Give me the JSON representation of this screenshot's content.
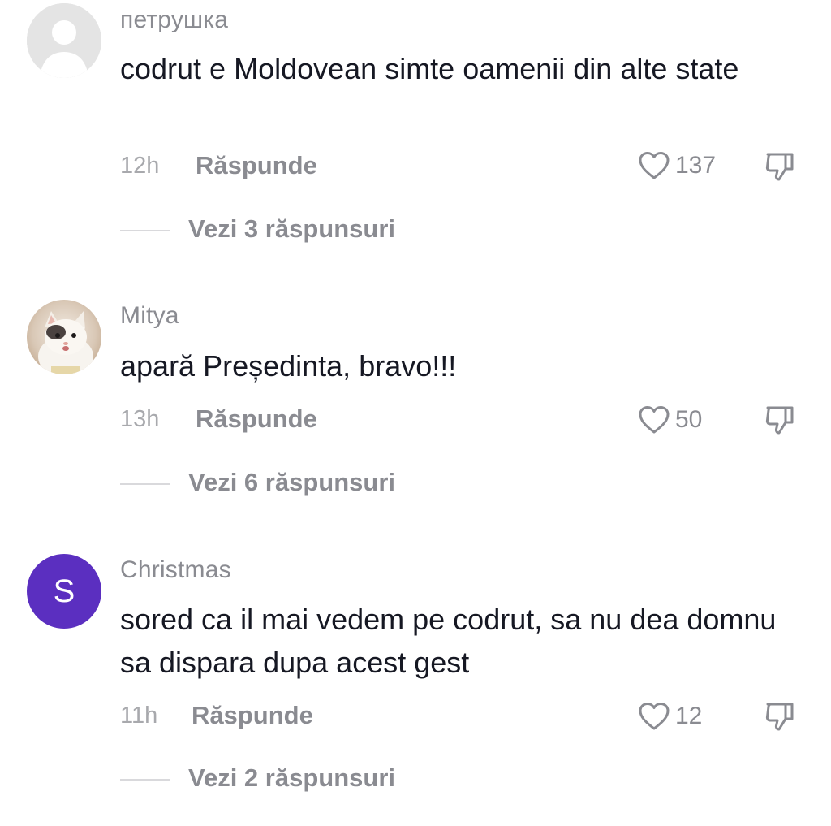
{
  "comments": [
    {
      "avatar": "default-person-avatar",
      "username": "петрушка",
      "text": "codrut e Moldovean simte oamenii din alte state",
      "time": "12h",
      "reply_label": "Răspunde",
      "likes": "137",
      "view_replies": "Vezi 3 răspunsuri"
    },
    {
      "avatar": "cat-photo-avatar",
      "username": "Mitya",
      "text": "apară Președinta, bravo!!!",
      "time": "13h",
      "reply_label": "Răspunde",
      "likes": "50",
      "view_replies": "Vezi 6 răspunsuri"
    },
    {
      "avatar": "letter-avatar",
      "avatar_letter": "S",
      "avatar_color": "#5b2fc0",
      "username": "Christmas",
      "text": "sored ca il mai vedem pe codrut, sa nu dea domnu sa dispara dupa acest gest",
      "time": "11h",
      "reply_label": "Răspunde",
      "likes": "12",
      "view_replies": "Vezi 2 răspunsuri"
    }
  ],
  "icons": {
    "like": "heart-outline-icon",
    "dislike": "thumbs-down-outline-icon"
  }
}
